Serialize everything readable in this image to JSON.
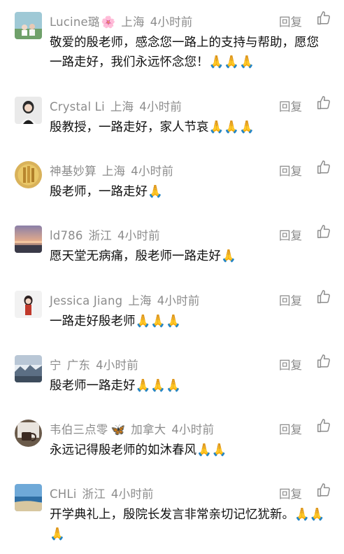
{
  "reply_label": "回复",
  "comments": [
    {
      "name": "Lucine璐",
      "name_emoji": "🌸",
      "location": "上海",
      "time": "4小时前",
      "text": "敬爱的殷老师，感念您一路上的支持与帮助，愿您一路走好，我们永远怀念您！🙏🙏🙏"
    },
    {
      "name": "Crystal Li",
      "location": "上海",
      "time": "4小时前",
      "text": "殷教授，一路走好，家人节哀🙏🙏🙏"
    },
    {
      "name": "神基妙算",
      "location": "上海",
      "time": "4小时前",
      "text": "殷老师，一路走好🙏"
    },
    {
      "name": "ld786",
      "location": "浙江",
      "time": "4小时前",
      "text": "愿天堂无病痛，殷老师一路走好🙏"
    },
    {
      "name": "Jessica Jiang",
      "location": "上海",
      "time": "4小时前",
      "text": "一路走好殷老师🙏🙏🙏"
    },
    {
      "name": "宁",
      "location": "广东",
      "time": "4小时前",
      "text": "殷老师一路走好🙏🙏🙏"
    },
    {
      "name": "韦伯三点零",
      "name_emoji": "🦋",
      "location": "加拿大",
      "time": "4小时前",
      "text": "永远记得殷老师的如沐春风🙏🙏"
    },
    {
      "name": "CHLi",
      "location": "浙江",
      "time": "4小时前",
      "text": "开学典礼上，殷院长发言非常亲切记忆犹新。🙏🙏🙏"
    }
  ]
}
